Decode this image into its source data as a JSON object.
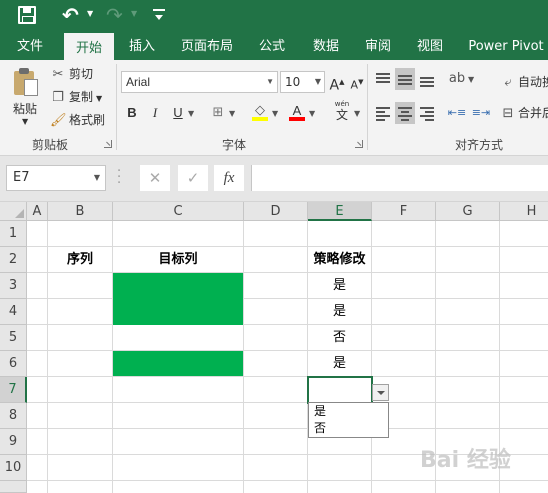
{
  "quick_access": {
    "save_icon": "save-icon",
    "undo_icon": "undo-icon",
    "redo_icon": "redo-icon"
  },
  "tabs": [
    {
      "label": "文件"
    },
    {
      "label": "开始"
    },
    {
      "label": "插入"
    },
    {
      "label": "页面布局"
    },
    {
      "label": "公式"
    },
    {
      "label": "数据"
    },
    {
      "label": "审阅"
    },
    {
      "label": "视图"
    },
    {
      "label": "Power Pivot"
    }
  ],
  "active_tab": "开始",
  "ribbon": {
    "clipboard": {
      "paste_label": "粘贴",
      "cut_label": "剪切",
      "copy_label": "复制",
      "format_painter_label": "格式刷",
      "group_label": "剪贴板"
    },
    "font": {
      "font_name": "Arial",
      "font_size": "10",
      "increase_label": "A",
      "decrease_label": "A",
      "bold_label": "B",
      "italic_label": "I",
      "underline_label": "U",
      "font_color_label": "A",
      "wen_label": "wén",
      "wen_char": "文",
      "group_label": "字体"
    },
    "alignment": {
      "wrap_label": "自动换",
      "merge_label": "合并后",
      "group_label": "对齐方式"
    }
  },
  "formula_bar": {
    "name_box": "E7",
    "cancel_icon": "✕",
    "enter_icon": "✓",
    "fx_label": "fx",
    "formula": ""
  },
  "sheet": {
    "columns": [
      "A",
      "B",
      "C",
      "D",
      "E",
      "F",
      "G",
      "H"
    ],
    "rows": [
      "1",
      "2",
      "3",
      "4",
      "5",
      "6",
      "7",
      "8",
      "9",
      "10"
    ],
    "headers": {
      "b2": "序列",
      "c2": "目标列",
      "e2": "策略修改"
    },
    "e_values": {
      "e3": "是",
      "e4": "是",
      "e5": "否",
      "e6": "是"
    },
    "fill_color": "#00b050",
    "dropdown_options": [
      "是",
      "否"
    ]
  },
  "watermark": "Bai 经验"
}
